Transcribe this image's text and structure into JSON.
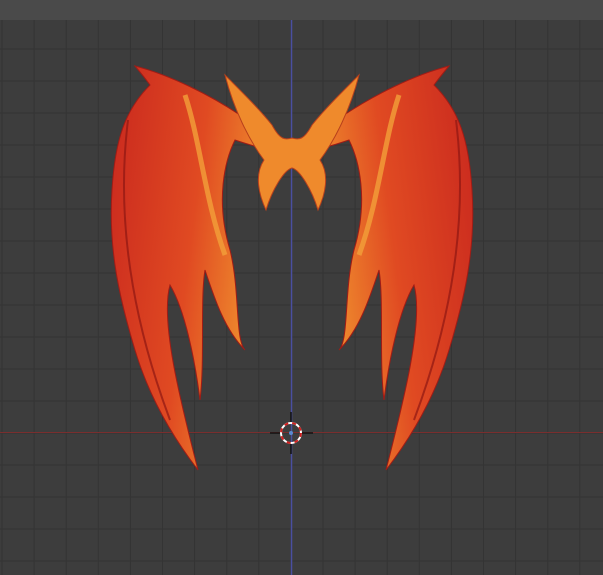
{
  "viewport": {
    "mode": "3d-viewport",
    "colors": {
      "background": "#3d3d3d",
      "grid": "#333333",
      "x_axis": "#8a2d2d",
      "z_axis": "#4a4fa0",
      "model_red": "#c9281e",
      "model_orange": "#f08a2a"
    },
    "icons": {
      "cursor": "3d-cursor-icon",
      "model": "wings-model"
    }
  }
}
